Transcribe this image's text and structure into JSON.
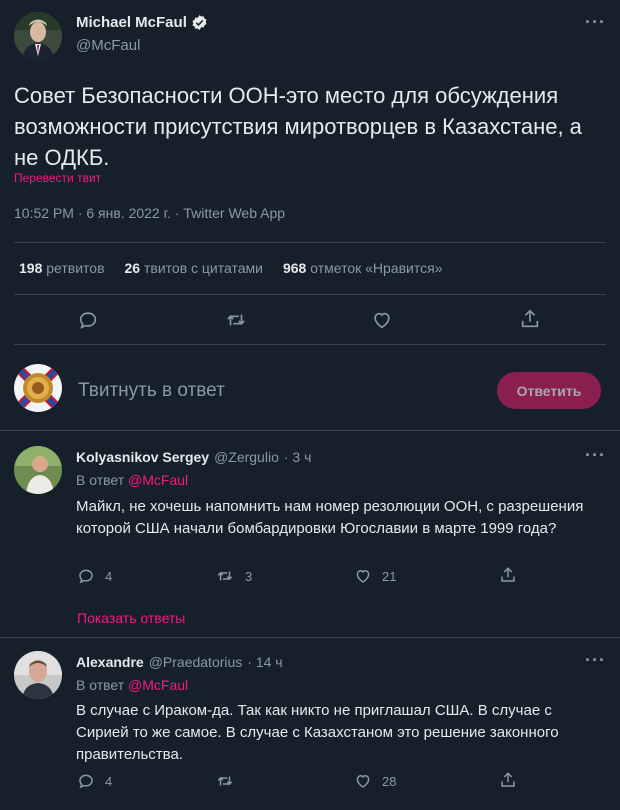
{
  "main_tweet": {
    "author_name": "Michael McFaul",
    "author_handle": "@McFaul",
    "text": "Совет Безопасности ООН-это место для обсуждения возможности присутствия миротворцев в Казахстане, а не ОДКБ.",
    "translate_label": "Перевести твит",
    "meta": "10:52 PM · 6 янв. 2022 г. · Twitter Web App",
    "stats": {
      "retweets_count": "198",
      "retweets_label": "ретвитов",
      "quotes_count": "26",
      "quotes_label": "твитов с цитатами",
      "likes_count": "968",
      "likes_label": "отметок «Нравится»"
    }
  },
  "reply_box": {
    "placeholder": "Твитнуть в ответ",
    "button_label": "Ответить"
  },
  "replies": [
    {
      "author_name": "Kolyasnikov Sergey",
      "author_handle": "@Zergulio",
      "time": "· 3 ч",
      "reply_to_prefix": "В ответ",
      "reply_to_handle": "@McFaul",
      "text": "Майкл, не хочешь напомнить нам номер резолюции ООН, с разрешения которой США начали бомбардировки Югославии в марте 1999 года?",
      "replies_count": "4",
      "retweets_count": "3",
      "likes_count": "21",
      "show_replies_label": "Показать ответы"
    },
    {
      "author_name": "Alexandre",
      "author_handle": "@Praedatorius",
      "time": "· 14 ч",
      "reply_to_prefix": "В ответ",
      "reply_to_handle": "@McFaul",
      "text": "В случае с Ираком-да. Так как никто не приглашал США. В случае с Сирией то же самое. В случае с Казахстаном это решение законного правительства.",
      "replies_count": "4",
      "retweets_count": "",
      "likes_count": "28"
    }
  ],
  "colors": {
    "background": "#15202b",
    "separator": "#38444d",
    "muted": "#8b98a5",
    "accent_pink": "#f91880",
    "button_bg": "#8a1e4f"
  }
}
